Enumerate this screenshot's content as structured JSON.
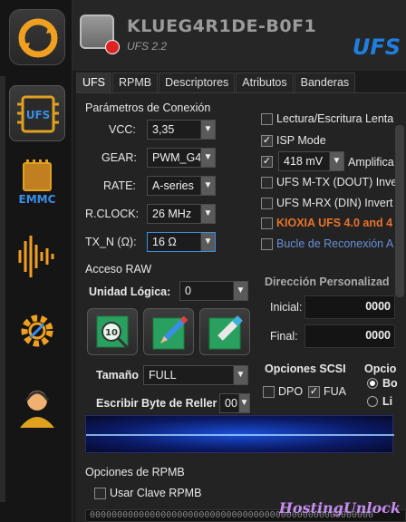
{
  "header": {
    "device_name": "KLUEG4R1DE-B0F1",
    "device_sub": "UFS 2.2",
    "brand": "UFS"
  },
  "tabs": [
    {
      "label": "UFS",
      "active": true
    },
    {
      "label": "RPMB",
      "active": false
    },
    {
      "label": "Descriptores",
      "active": false
    },
    {
      "label": "Atributos",
      "active": false
    },
    {
      "label": "Banderas",
      "active": false
    }
  ],
  "connection": {
    "title": "Parámetros de Conexión",
    "vcc_label": "VCC:",
    "vcc_value": "3,35",
    "gear_label": "GEAR:",
    "gear_value": "PWM_G4",
    "rate_label": "RATE:",
    "rate_value": "A-series",
    "rclock_label": "R.CLOCK:",
    "rclock_value": "26 MHz",
    "txn_label": "TX_N (Ω):",
    "txn_value": "16 Ω"
  },
  "options": {
    "lectura": {
      "label": "Lectura/Escritura Lenta",
      "checked": false
    },
    "isp": {
      "label": "ISP Mode",
      "checked": true
    },
    "ampl_value": "418 mV",
    "ampl_label": "Amplifica",
    "ampl_checked": true,
    "mtx": {
      "label": "UFS M-TX (DOUT) Inve",
      "checked": false
    },
    "mrx": {
      "label": "UFS M-RX (DIN) Invert",
      "checked": false
    },
    "kioxia": {
      "label": "KIOXIA UFS 4.0 and 4",
      "checked": false
    },
    "bucle": {
      "label": "Bucle de Reconexión A",
      "checked": false
    }
  },
  "raw": {
    "title": "Acceso RAW",
    "unit_label": "Unidad Lógica:",
    "unit_value": "0",
    "size_label": "Tamaño",
    "size_value": "FULL",
    "fill_label": "Escribir Byte de Reller",
    "fill_value": "00"
  },
  "direction": {
    "title": "Dirección Personalizad",
    "start_label": "Inicial:",
    "start_value": "0000",
    "end_label": "Final:",
    "end_value": "0000"
  },
  "scsi": {
    "title": "Opciones SCSI",
    "dpo_label": "DPO",
    "dpo_checked": false,
    "fua_label": "FUA",
    "fua_checked": true
  },
  "opc": {
    "title": "Opcio",
    "opt1": "Bo",
    "opt2": "Li"
  },
  "rpmb": {
    "title": "Opciones de RPMB",
    "use_key_label": "Usar Clave RPMB",
    "use_key_checked": false,
    "key_value": "0000000000000000000000000000000000000000000000000000"
  },
  "watermark": "HostingUnlock",
  "colors": {
    "accent": "#1f7fe0",
    "bg": "#232323",
    "kioxia": "#e8732a",
    "bucle": "#6a8fd8"
  }
}
